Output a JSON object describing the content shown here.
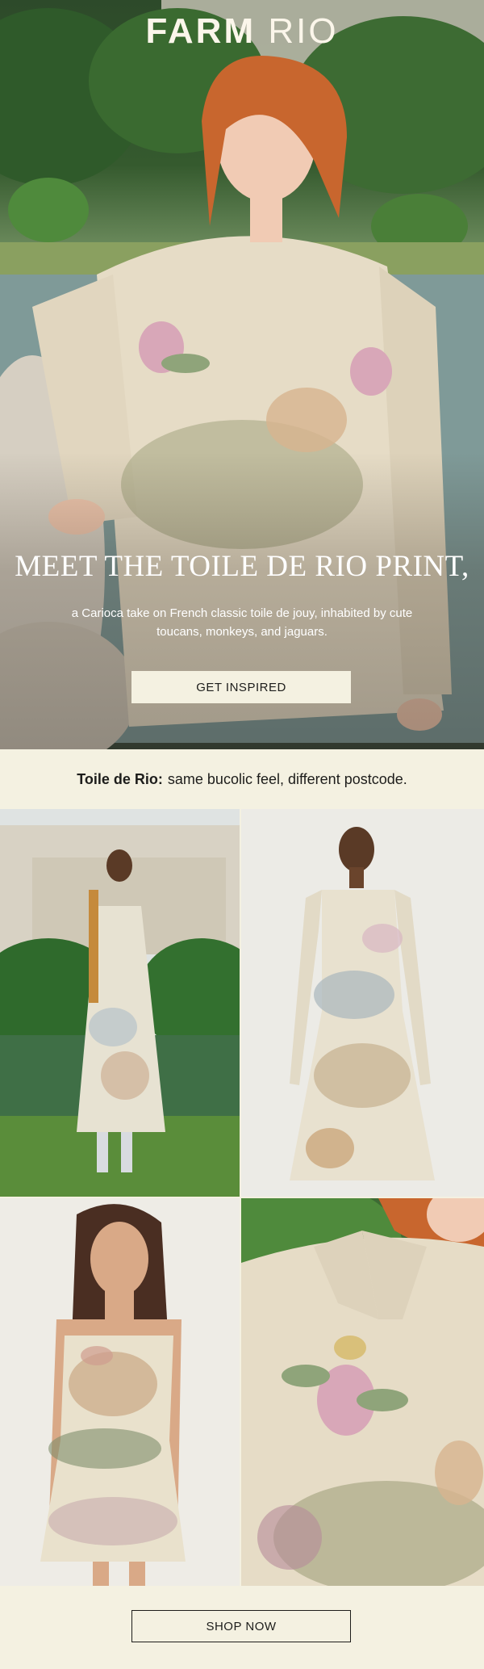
{
  "brand": {
    "logo_part1": "FARM",
    "logo_part2": "RIO"
  },
  "hero": {
    "heading": "MEET THE TOILE DE RIO PRINT,",
    "subtext": "a Carioca take on French classic toile de jouy, inhabited by cute toucans, monkeys, and jaguars.",
    "cta_label": "GET INSPIRED",
    "image": "model in cream floral embroidered shirt by lake"
  },
  "tagline": {
    "bold": "Toile de Rio:",
    "rest": "same bucolic feel, different postcode."
  },
  "grid": [
    {
      "image": "model in toile slip dress in park"
    },
    {
      "image": "model in long-sleeve toile maxi dress"
    },
    {
      "image": "model in toile strappy mini dress"
    },
    {
      "image": "close-up of floral embroidered shirt"
    }
  ],
  "footer": {
    "cta_label": "SHOP NOW"
  },
  "colors": {
    "cream": "#f4f1e1",
    "ink": "#1d1d1b"
  }
}
